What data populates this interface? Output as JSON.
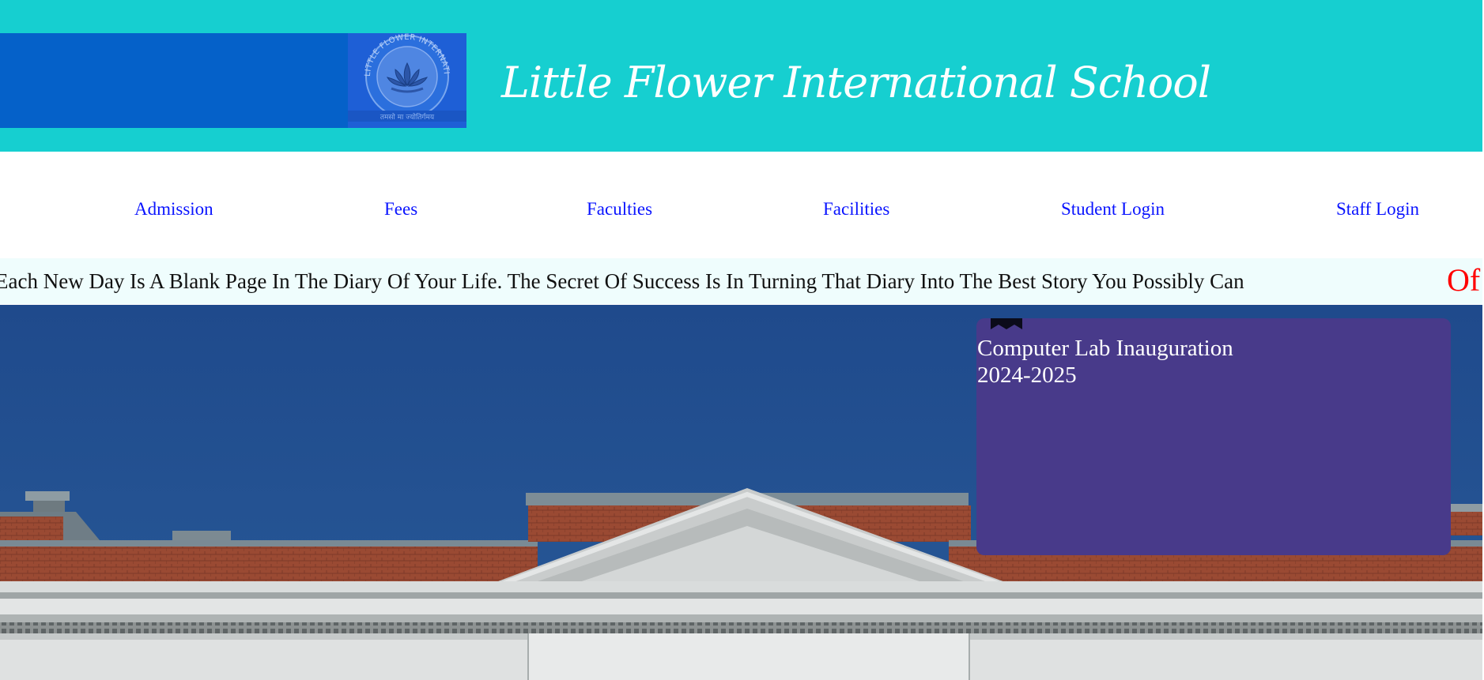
{
  "header": {
    "title": "Little Flower International School",
    "logo_name": "school-emblem-logo",
    "logo_ring_text": "LITTLE FLOWER INTERNATIONAL SCHOOL",
    "logo_motto": "तमसो मा ज्योतिर्गमय"
  },
  "nav": {
    "items": [
      {
        "label": "Admission"
      },
      {
        "label": "Fees"
      },
      {
        "label": "Faculties"
      },
      {
        "label": "Facilities"
      },
      {
        "label": "Student Login"
      },
      {
        "label": "Staff Login"
      }
    ]
  },
  "marquee": {
    "text": "Each New Day Is A Blank Page In The Diary Of Your Life. The Secret Of Success Is In Turning That Diary Into The Best Story You Possibly Can",
    "next_text": "Of"
  },
  "news": {
    "title": "Computer Lab Inauguration",
    "year": "2024-2025",
    "ribbon_icon": "bookmark-icon"
  },
  "colors": {
    "header_bg": "#16cfd0",
    "header_band": "#0561c9",
    "nav_link": "#0a14ff",
    "marquee_bg": "#effdfd",
    "marquee_accent": "#ff0000",
    "news_card_bg": "#483a8a",
    "sky": "#224f90"
  }
}
